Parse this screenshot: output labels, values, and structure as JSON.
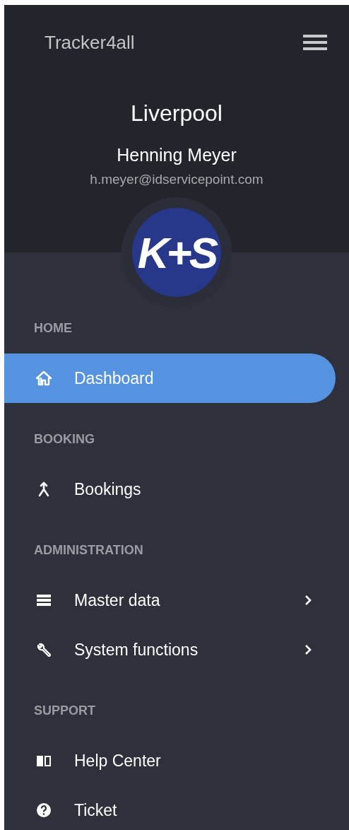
{
  "header": {
    "app_title": "Tracker4all",
    "location": "Liverpool",
    "user_name": "Henning Meyer",
    "user_email": "h.meyer@idservicepoint.com",
    "logo_text": "K+S"
  },
  "sections": [
    {
      "label": "HOME",
      "items": [
        {
          "label": "Dashboard",
          "selected": true,
          "has_submenu": false
        }
      ]
    },
    {
      "label": "BOOKING",
      "items": [
        {
          "label": "Bookings",
          "selected": false,
          "has_submenu": false
        }
      ]
    },
    {
      "label": "ADMINISTRATION",
      "items": [
        {
          "label": "Master data",
          "selected": false,
          "has_submenu": true
        },
        {
          "label": "System functions",
          "selected": false,
          "has_submenu": true
        }
      ]
    },
    {
      "label": "SUPPORT",
      "items": [
        {
          "label": "Help Center",
          "selected": false,
          "has_submenu": false
        },
        {
          "label": "Ticket",
          "selected": false,
          "has_submenu": false
        }
      ]
    }
  ]
}
